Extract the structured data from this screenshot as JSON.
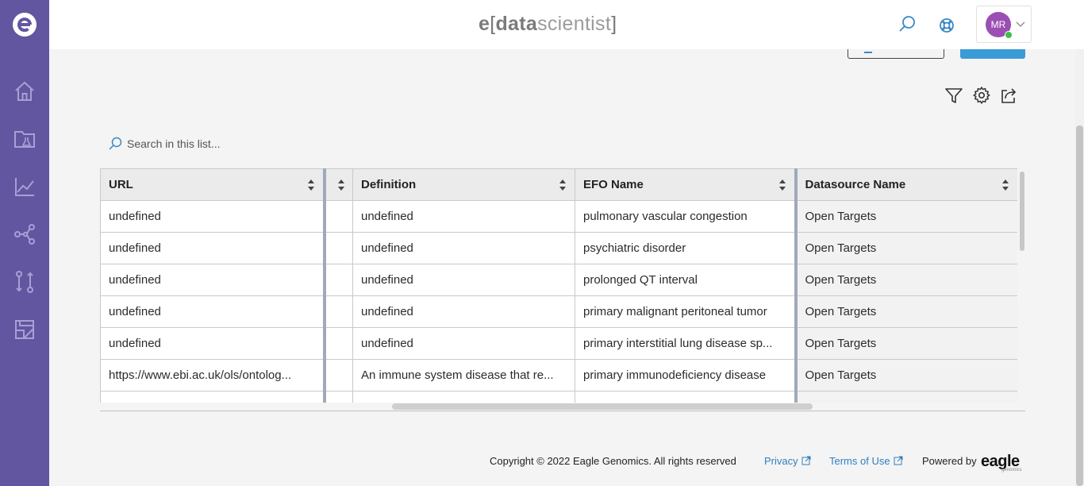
{
  "brand": {
    "e": "e",
    "open": "[",
    "data": "data",
    "scientist": "scientist",
    "close": "]"
  },
  "user": {
    "initials": "MR"
  },
  "search": {
    "placeholder": "Search in this list..."
  },
  "table": {
    "columns": [
      "URL",
      "",
      "Definition",
      "EFO Name",
      "Datasource Name"
    ],
    "rows": [
      [
        "undefined",
        "",
        "undefined",
        "pulmonary vascular congestion",
        "Open Targets"
      ],
      [
        "undefined",
        "",
        "undefined",
        "psychiatric disorder",
        "Open Targets"
      ],
      [
        "undefined",
        "",
        "undefined",
        "prolonged QT interval",
        "Open Targets"
      ],
      [
        "undefined",
        "",
        "undefined",
        "primary malignant peritoneal tumor",
        "Open Targets"
      ],
      [
        "undefined",
        "",
        "undefined",
        "primary interstitial lung disease sp...",
        "Open Targets"
      ],
      [
        "https://www.ebi.ac.uk/ols/ontolog...",
        "",
        "An immune system disease that re...",
        "primary immunodeficiency disease",
        "Open Targets"
      ],
      [
        "",
        "",
        "",
        "",
        ""
      ]
    ]
  },
  "footer": {
    "copyright": "Copyright © 2022 Eagle Genomics. All rights reserved",
    "privacy": "Privacy",
    "terms": "Terms of Use",
    "powered": "Powered by",
    "logo_word": "eagle",
    "logo_sub": "genomics"
  },
  "icons": {
    "sidebar": [
      "home-icon",
      "data-folder-icon",
      "analytics-chart-icon",
      "network-graph-icon",
      "workflow-compare-icon",
      "reports-icon"
    ],
    "toolbar": [
      "filter-icon",
      "settings-gear-icon",
      "share-export-icon"
    ]
  },
  "colors": {
    "sidebar": "#6356a0",
    "accent": "#3a9bd6",
    "avatar": "#9b4fb2",
    "presence": "#3cbf48",
    "link": "#2f7fc1"
  }
}
